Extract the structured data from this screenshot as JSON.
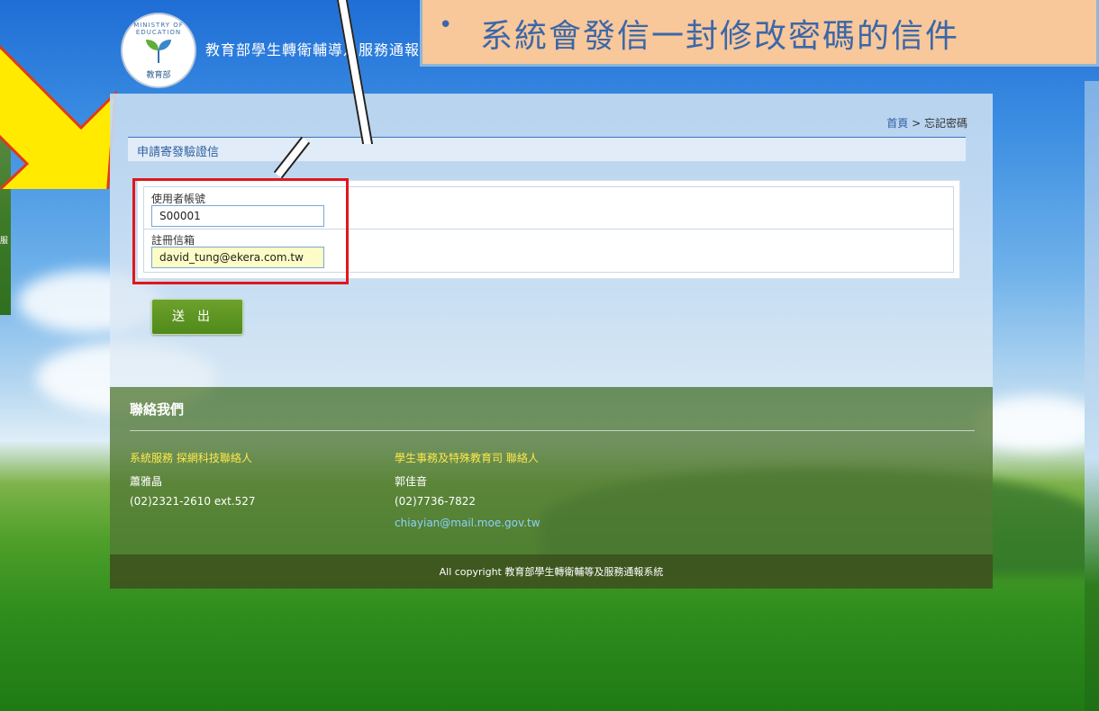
{
  "site": {
    "title": "教育部學生轉衛輔導及服務通報系統"
  },
  "callout": {
    "bullet": "•",
    "text": "系統會發信一封修改密碼的信件"
  },
  "breadcrumb": {
    "home": "首頁",
    "separator": " > ",
    "current": "忘記密碼"
  },
  "section": {
    "title": "申請寄發驗證信"
  },
  "form": {
    "account_label": "使用者帳號",
    "account_value": "S00001",
    "email_label": "註冊信箱",
    "email_value": "david_tung@ekera.com.tw",
    "submit_label": "送出"
  },
  "footer": {
    "heading": "聯絡我們",
    "contact1": {
      "title": "系統服務 探網科技聯絡人",
      "name": "蕭雅晶",
      "phone": "(02)2321-2610 ext.527"
    },
    "contact2": {
      "title": "學生事務及特殊教育司 聯絡人",
      "name": "郭佳音",
      "phone": "(02)7736-7822",
      "email": "chiayian@mail.moe.gov.tw"
    },
    "copyright": "All copyright 教育部學生轉衛輔等及服務通報系統"
  },
  "logo": {
    "ring_text": "MINISTRY OF EDUCATION",
    "seal_text": "教育部"
  },
  "colors": {
    "highlight": "#e1171c",
    "callout_bg": "#f8c79a",
    "arrow": "#ffea00",
    "button": "#5a951f"
  },
  "icons": {
    "arrow": "yellow-arrow-icon",
    "logo": "ministry-logo-icon"
  }
}
